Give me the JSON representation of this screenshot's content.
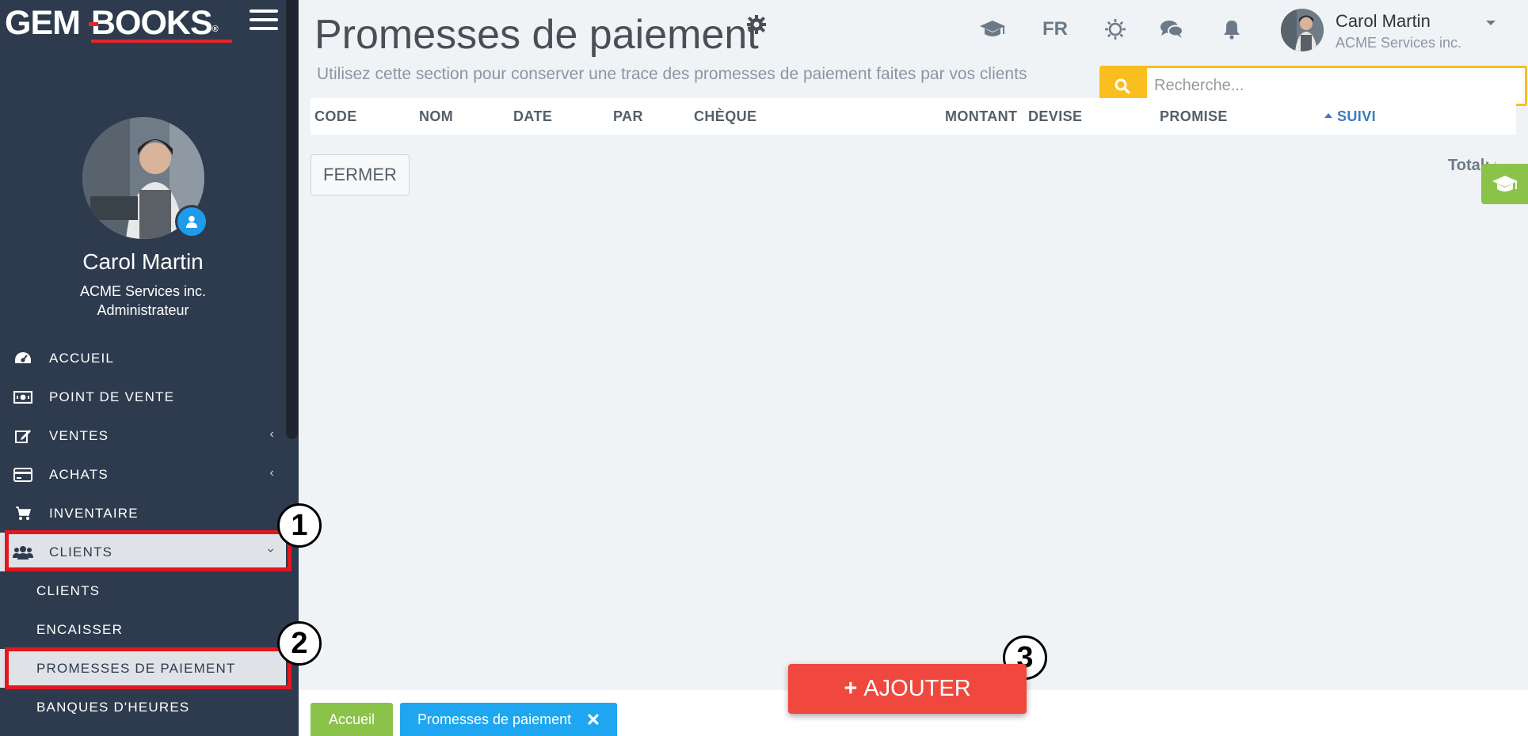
{
  "app": {
    "logo_left": "GEM",
    "logo_right": "BOOKS",
    "logo_reg": "®"
  },
  "sidebar": {
    "profile": {
      "name": "Carol Martin",
      "company": "ACME Services inc.",
      "role": "Administrateur"
    },
    "items": [
      {
        "label": "ACCUEIL",
        "icon": "dashboard-icon"
      },
      {
        "label": "POINT DE VENTE",
        "icon": "cash-icon"
      },
      {
        "label": "VENTES",
        "icon": "edit-icon",
        "chevron": "‹"
      },
      {
        "label": "ACHATS",
        "icon": "credit-card-icon",
        "chevron": "‹"
      },
      {
        "label": "INVENTAIRE",
        "icon": "cart-icon"
      },
      {
        "label": "CLIENTS",
        "icon": "users-icon",
        "chevron": "›"
      }
    ],
    "subitems": [
      {
        "label": "CLIENTS"
      },
      {
        "label": "ENCAISSER"
      },
      {
        "label": "PROMESSES DE PAIEMENT"
      },
      {
        "label": "BANQUES D'HEURES"
      }
    ]
  },
  "markers": [
    "1",
    "2",
    "3"
  ],
  "header": {
    "title": "Promesses de paiement",
    "subtitle": "Utilisez cette section pour conserver une trace des promesses de paiement faites par vos clients",
    "language": "FR",
    "user": {
      "name": "Carol Martin",
      "company": "ACME Services inc."
    }
  },
  "search": {
    "placeholder": "Recherche..."
  },
  "table": {
    "columns": [
      "CODE",
      "NOM",
      "DATE",
      "PAR",
      "CHÈQUE",
      "MONTANT",
      "DEVISE",
      "PROMISE",
      "SUIVI"
    ],
    "sorted_column": "SUIVI"
  },
  "actions": {
    "close_label": "FERMER",
    "total_label": "Total: 0",
    "add_label": "AJOUTER",
    "add_prefix": "+"
  },
  "footer": {
    "tabs": [
      "Accueil",
      "Promesses de paiement"
    ]
  },
  "colors": {
    "sidebar_bg": "#2e3b4e",
    "accent_red": "#f0483e",
    "search_yellow": "#fabe1e",
    "green": "#8bc34a",
    "blue": "#1ea7f0",
    "highlight_red": "#e4161e"
  }
}
